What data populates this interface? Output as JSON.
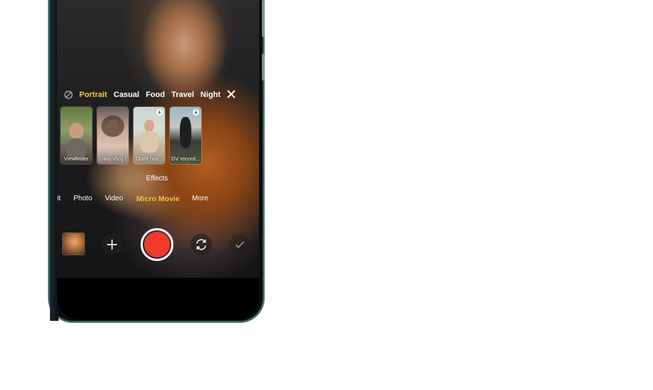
{
  "filters": {
    "items": [
      {
        "label": "Portrait",
        "active": true
      },
      {
        "label": "Casual",
        "active": false
      },
      {
        "label": "Food",
        "active": false
      },
      {
        "label": "Travel",
        "active": false
      },
      {
        "label": "Night",
        "active": false
      }
    ]
  },
  "templates": [
    {
      "label": "Viewfinder",
      "download": false
    },
    {
      "label": "Daily Vlog I",
      "download": false
    },
    {
      "label": "Outfit hist...",
      "download": true
    },
    {
      "label": "DV record...",
      "download": true
    }
  ],
  "effects_label": "Effects",
  "modes": {
    "partial": "it",
    "photo": "Photo",
    "video": "Video",
    "micro_movie": "Micro Movie",
    "more": "More"
  },
  "colors": {
    "accent": "#f4c23d",
    "shutter": "#ef3b2c"
  }
}
